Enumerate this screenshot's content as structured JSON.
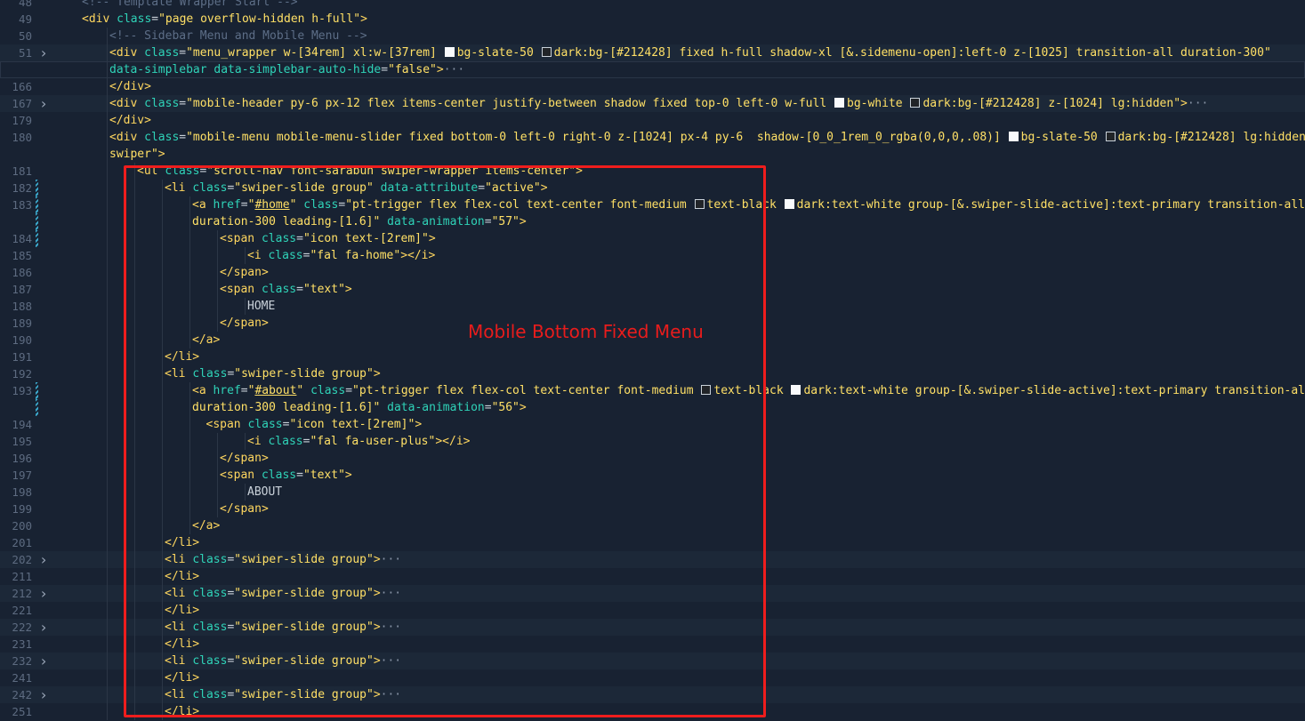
{
  "annotation": {
    "label": "Mobile Bottom Fixed Menu",
    "color": "#ef1d1d"
  },
  "colors": {
    "background": "#182232",
    "tag": "#ffd75f",
    "attribute": "#2fd3b8",
    "string": "#ffe066",
    "comment": "#5d6e87",
    "line_number": "#5d6b80"
  },
  "lines": [
    {
      "n": "48",
      "indent": 1,
      "tokens": [
        [
          "cm",
          "<!-- Template Wrapper Start -->"
        ]
      ]
    },
    {
      "n": "49",
      "indent": 1,
      "tokens": [
        [
          "tag",
          "<div "
        ],
        [
          "attr",
          "class"
        ],
        [
          "txt",
          "="
        ],
        [
          "str",
          "\"page overflow-hidden h-full\""
        ],
        [
          "tag",
          ">"
        ]
      ]
    },
    {
      "n": "50",
      "indent": 2,
      "tokens": [
        [
          "cm",
          "<!-- Sidebar Menu and Mobile Menu -->"
        ]
      ]
    },
    {
      "n": "51",
      "indent": 2,
      "fold": true,
      "hl": true,
      "tokens": [
        [
          "tag",
          "<div "
        ],
        [
          "attr",
          "class"
        ],
        [
          "txt",
          "="
        ],
        [
          "str",
          "\"menu_wrapper w-[34rem] xl:w-[37rem] "
        ],
        [
          "sw",
          "w"
        ],
        [
          "str",
          "bg-slate-50 "
        ],
        [
          "sw",
          "d"
        ],
        [
          "str",
          "dark:bg-[#212428] fixed h-full shadow-xl [&.sidemenu-open]:left-0 z-[1025] transition-all duration-300\""
        ]
      ]
    },
    {
      "n": "",
      "indent": 2,
      "cur": true,
      "tokens": [
        [
          "attr",
          "data-simplebar data-simplebar-auto-hide"
        ],
        [
          "txt",
          "="
        ],
        [
          "str",
          "\"false\""
        ],
        [
          "tag",
          ">"
        ],
        [
          "fold",
          "···"
        ]
      ]
    },
    {
      "n": "166",
      "indent": 2,
      "tokens": [
        [
          "tag",
          "</div>"
        ]
      ]
    },
    {
      "n": "167",
      "indent": 2,
      "fold": true,
      "hl": true,
      "tokens": [
        [
          "tag",
          "<div "
        ],
        [
          "attr",
          "class"
        ],
        [
          "txt",
          "="
        ],
        [
          "str",
          "\"mobile-header py-6 px-12 flex items-center justify-between shadow fixed top-0 left-0 w-full "
        ],
        [
          "sw",
          "w"
        ],
        [
          "str",
          "bg-white "
        ],
        [
          "sw",
          "d"
        ],
        [
          "str",
          "dark:bg-[#212428] z-[1024] lg:hidden\""
        ],
        [
          "tag",
          ">"
        ],
        [
          "fold",
          "···"
        ]
      ]
    },
    {
      "n": "179",
      "indent": 2,
      "tokens": [
        [
          "tag",
          "</div>"
        ]
      ]
    },
    {
      "n": "180",
      "indent": 2,
      "tokens": [
        [
          "tag",
          "<div "
        ],
        [
          "attr",
          "class"
        ],
        [
          "txt",
          "="
        ],
        [
          "str",
          "\"mobile-menu mobile-menu-slider fixed bottom-0 left-0 right-0 z-[1024] px-4 py-6  shadow-[0_0_1rem_0_rgba(0,0,0,.08)] "
        ],
        [
          "sw",
          "w"
        ],
        [
          "str",
          "bg-slate-50 "
        ],
        [
          "sw",
          "d"
        ],
        [
          "str",
          "dark:bg-[#212428] lg:hidden"
        ]
      ]
    },
    {
      "n": "",
      "indent": 2,
      "tokens": [
        [
          "str",
          "swiper\""
        ],
        [
          "tag",
          ">"
        ]
      ]
    },
    {
      "n": "181",
      "indent": 3,
      "tokens": [
        [
          "tag",
          "<ul "
        ],
        [
          "attr",
          "class"
        ],
        [
          "txt",
          "="
        ],
        [
          "str",
          "\"scroll-nav font-sarabun swiper-wrapper items-center\""
        ],
        [
          "tag",
          ">"
        ]
      ]
    },
    {
      "n": "182",
      "indent": 4,
      "mod": true,
      "tokens": [
        [
          "tag",
          "<li "
        ],
        [
          "attr",
          "class"
        ],
        [
          "txt",
          "="
        ],
        [
          "str",
          "\"swiper-slide group\" "
        ],
        [
          "attr",
          "data-attribute"
        ],
        [
          "txt",
          "="
        ],
        [
          "str",
          "\"active\""
        ],
        [
          "tag",
          ">"
        ]
      ]
    },
    {
      "n": "183",
      "indent": 5,
      "mod": true,
      "tokens": [
        [
          "tag",
          "<a "
        ],
        [
          "attr",
          "href"
        ],
        [
          "txt",
          "="
        ],
        [
          "str",
          "\""
        ],
        [
          "href",
          "#home"
        ],
        [
          "str",
          "\" "
        ],
        [
          "attr",
          "class"
        ],
        [
          "txt",
          "="
        ],
        [
          "str",
          "\"pt-trigger flex flex-col text-center font-medium "
        ],
        [
          "sw",
          "d"
        ],
        [
          "str",
          "text-black "
        ],
        [
          "sw",
          "w"
        ],
        [
          "str",
          "dark:text-white group-[&.swiper-slide-active]:text-primary transition-all"
        ]
      ]
    },
    {
      "n": "",
      "indent": 5,
      "mod": true,
      "tokens": [
        [
          "str",
          "duration-300 leading-[1.6]\" "
        ],
        [
          "attr",
          "data-animation"
        ],
        [
          "txt",
          "="
        ],
        [
          "str",
          "\"57\""
        ],
        [
          "tag",
          ">"
        ]
      ]
    },
    {
      "n": "184",
      "indent": 6,
      "mod": true,
      "tokens": [
        [
          "tag",
          "<span "
        ],
        [
          "attr",
          "class"
        ],
        [
          "txt",
          "="
        ],
        [
          "str",
          "\"icon text-[2rem]\""
        ],
        [
          "tag",
          ">"
        ]
      ]
    },
    {
      "n": "185",
      "indent": 7,
      "tokens": [
        [
          "tag",
          "<i "
        ],
        [
          "attr",
          "class"
        ],
        [
          "txt",
          "="
        ],
        [
          "str",
          "\"fal fa-home\""
        ],
        [
          "tag",
          "></i>"
        ]
      ]
    },
    {
      "n": "186",
      "indent": 6,
      "tokens": [
        [
          "tag",
          "</span>"
        ]
      ]
    },
    {
      "n": "187",
      "indent": 6,
      "tokens": [
        [
          "tag",
          "<span "
        ],
        [
          "attr",
          "class"
        ],
        [
          "txt",
          "="
        ],
        [
          "str",
          "\"text\""
        ],
        [
          "tag",
          ">"
        ]
      ]
    },
    {
      "n": "188",
      "indent": 7,
      "tokens": [
        [
          "txt",
          "HOME"
        ]
      ]
    },
    {
      "n": "189",
      "indent": 6,
      "tokens": [
        [
          "tag",
          "</span>"
        ]
      ]
    },
    {
      "n": "190",
      "indent": 5,
      "tokens": [
        [
          "tag",
          "</a>"
        ]
      ]
    },
    {
      "n": "191",
      "indent": 4,
      "tokens": [
        [
          "tag",
          "</li>"
        ]
      ]
    },
    {
      "n": "192",
      "indent": 4,
      "tokens": [
        [
          "tag",
          "<li "
        ],
        [
          "attr",
          "class"
        ],
        [
          "txt",
          "="
        ],
        [
          "str",
          "\"swiper-slide group\""
        ],
        [
          "tag",
          ">"
        ]
      ]
    },
    {
      "n": "193",
      "indent": 5,
      "mod": true,
      "tokens": [
        [
          "tag",
          "<a "
        ],
        [
          "attr",
          "href"
        ],
        [
          "txt",
          "="
        ],
        [
          "str",
          "\""
        ],
        [
          "href",
          "#about"
        ],
        [
          "str",
          "\" "
        ],
        [
          "attr",
          "class"
        ],
        [
          "txt",
          "="
        ],
        [
          "str",
          "\"pt-trigger flex flex-col text-center font-medium "
        ],
        [
          "sw",
          "d"
        ],
        [
          "str",
          "text-black "
        ],
        [
          "sw",
          "w"
        ],
        [
          "str",
          "dark:text-white group-[&.swiper-slide-active]:text-primary transition-all"
        ]
      ]
    },
    {
      "n": "",
      "indent": 5,
      "mod": true,
      "tokens": [
        [
          "str",
          "duration-300 leading-[1.6]\" "
        ],
        [
          "attr",
          "data-animation"
        ],
        [
          "txt",
          "="
        ],
        [
          "str",
          "\"56\""
        ],
        [
          "tag",
          ">"
        ]
      ]
    },
    {
      "n": "194",
      "indent": 5.5,
      "tokens": [
        [
          "tag",
          "<span "
        ],
        [
          "attr",
          "class"
        ],
        [
          "txt",
          "="
        ],
        [
          "str",
          "\"icon text-[2rem]\""
        ],
        [
          "tag",
          ">"
        ]
      ]
    },
    {
      "n": "195",
      "indent": 7,
      "tokens": [
        [
          "tag",
          "<i "
        ],
        [
          "attr",
          "class"
        ],
        [
          "txt",
          "="
        ],
        [
          "str",
          "\"fal fa-user-plus\""
        ],
        [
          "tag",
          "></i>"
        ]
      ]
    },
    {
      "n": "196",
      "indent": 6,
      "tokens": [
        [
          "tag",
          "</span>"
        ]
      ]
    },
    {
      "n": "197",
      "indent": 6,
      "tokens": [
        [
          "tag",
          "<span "
        ],
        [
          "attr",
          "class"
        ],
        [
          "txt",
          "="
        ],
        [
          "str",
          "\"text\""
        ],
        [
          "tag",
          ">"
        ]
      ]
    },
    {
      "n": "198",
      "indent": 7,
      "tokens": [
        [
          "txt",
          "ABOUT"
        ]
      ]
    },
    {
      "n": "199",
      "indent": 6,
      "tokens": [
        [
          "tag",
          "</span>"
        ]
      ]
    },
    {
      "n": "200",
      "indent": 5,
      "tokens": [
        [
          "tag",
          "</a>"
        ]
      ]
    },
    {
      "n": "201",
      "indent": 4,
      "tokens": [
        [
          "tag",
          "</li>"
        ]
      ]
    },
    {
      "n": "202",
      "indent": 4,
      "fold": true,
      "hl": true,
      "tokens": [
        [
          "tag",
          "<li "
        ],
        [
          "attr",
          "class"
        ],
        [
          "txt",
          "="
        ],
        [
          "str",
          "\"swiper-slide group\""
        ],
        [
          "tag",
          ">"
        ],
        [
          "fold",
          "···"
        ]
      ]
    },
    {
      "n": "211",
      "indent": 4,
      "tokens": [
        [
          "tag",
          "</li>"
        ]
      ]
    },
    {
      "n": "212",
      "indent": 4,
      "fold": true,
      "hl": true,
      "tokens": [
        [
          "tag",
          "<li "
        ],
        [
          "attr",
          "class"
        ],
        [
          "txt",
          "="
        ],
        [
          "str",
          "\"swiper-slide group\""
        ],
        [
          "tag",
          ">"
        ],
        [
          "fold",
          "···"
        ]
      ]
    },
    {
      "n": "221",
      "indent": 4,
      "tokens": [
        [
          "tag",
          "</li>"
        ]
      ]
    },
    {
      "n": "222",
      "indent": 4,
      "fold": true,
      "hl": true,
      "tokens": [
        [
          "tag",
          "<li "
        ],
        [
          "attr",
          "class"
        ],
        [
          "txt",
          "="
        ],
        [
          "str",
          "\"swiper-slide group\""
        ],
        [
          "tag",
          ">"
        ],
        [
          "fold",
          "···"
        ]
      ]
    },
    {
      "n": "231",
      "indent": 4,
      "tokens": [
        [
          "tag",
          "</li>"
        ]
      ]
    },
    {
      "n": "232",
      "indent": 4,
      "fold": true,
      "hl": true,
      "tokens": [
        [
          "tag",
          "<li "
        ],
        [
          "attr",
          "class"
        ],
        [
          "txt",
          "="
        ],
        [
          "str",
          "\"swiper-slide group\""
        ],
        [
          "tag",
          ">"
        ],
        [
          "fold",
          "···"
        ]
      ]
    },
    {
      "n": "241",
      "indent": 4,
      "tokens": [
        [
          "tag",
          "</li>"
        ]
      ]
    },
    {
      "n": "242",
      "indent": 4,
      "fold": true,
      "hl": true,
      "tokens": [
        [
          "tag",
          "<li "
        ],
        [
          "attr",
          "class"
        ],
        [
          "txt",
          "="
        ],
        [
          "str",
          "\"swiper-slide group\""
        ],
        [
          "tag",
          ">"
        ],
        [
          "fold",
          "···"
        ]
      ]
    },
    {
      "n": "251",
      "indent": 4,
      "tokens": [
        [
          "tag",
          "</li>"
        ]
      ]
    }
  ]
}
